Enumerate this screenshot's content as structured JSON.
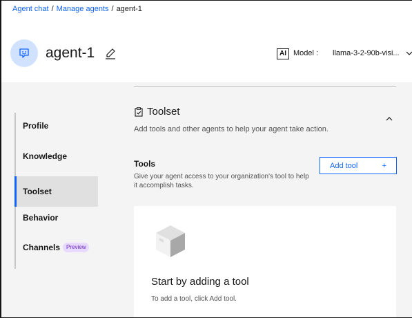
{
  "breadcrumb": {
    "items": [
      "Agent chat",
      "Manage agents",
      "agent-1"
    ],
    "separator": "/"
  },
  "agent": {
    "name": "agent-1",
    "avatar_icon": "chat-bot-icon",
    "edit_icon": "edit-icon"
  },
  "model": {
    "badge": "AI",
    "label": "Model :",
    "value": "llama-3-2-90b-visi..."
  },
  "sidenav": {
    "items": [
      {
        "label": "Profile"
      },
      {
        "label": "Knowledge"
      },
      {
        "label": "Toolset",
        "active": true
      },
      {
        "label": "Behavior"
      },
      {
        "label": "Channels",
        "tag": "Preview"
      }
    ]
  },
  "toolset": {
    "title": "Toolset",
    "description": "Add tools and other agents to help your agent take action.",
    "tools_label": "Tools",
    "tools_description": "Give your agent access to your organization's tool to help it accomplish tasks.",
    "add_tool_label": "Add tool",
    "add_tool_icon": "+"
  },
  "empty_state": {
    "title": "Start by adding a tool",
    "description": "To add a tool, click Add tool."
  },
  "colors": {
    "accent": "#0f62fe",
    "background": "#f4f4f4",
    "avatar_bg": "#d0e2ff",
    "preview_tag_bg": "#e8daff",
    "preview_tag_text": "#6929c4"
  }
}
